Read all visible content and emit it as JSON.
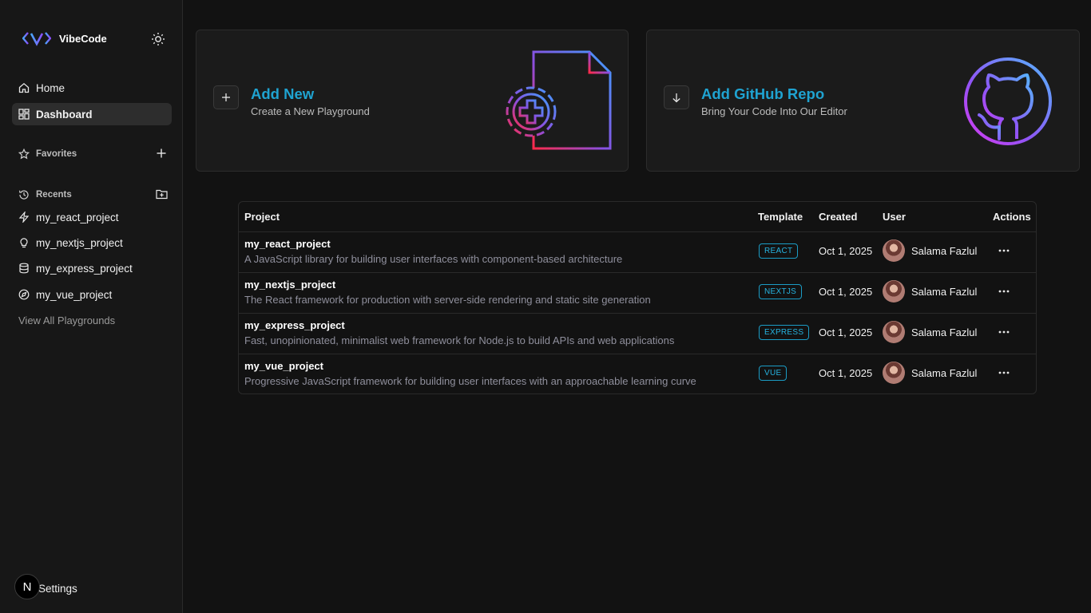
{
  "sidebar": {
    "brand": "VibeCode",
    "nav": [
      {
        "label": "Home"
      },
      {
        "label": "Dashboard"
      }
    ],
    "favorites_label": "Favorites",
    "recents_label": "Recents",
    "recents": [
      {
        "label": "my_react_project",
        "icon": "zap-icon"
      },
      {
        "label": "my_nextjs_project",
        "icon": "lightbulb-icon"
      },
      {
        "label": "my_express_project",
        "icon": "database-icon"
      },
      {
        "label": "my_vue_project",
        "icon": "compass-icon"
      }
    ],
    "view_all": "View All Playgrounds",
    "settings": "Settings",
    "badge": "N"
  },
  "cards": {
    "add_new": {
      "title": "Add New",
      "subtitle": "Create a New Playground"
    },
    "github": {
      "title": "Add GitHub Repo",
      "subtitle": "Bring Your Code Into Our Editor"
    }
  },
  "table": {
    "headers": {
      "project": "Project",
      "template": "Template",
      "created": "Created",
      "user": "User",
      "actions": "Actions"
    },
    "rows": [
      {
        "name": "my_react_project",
        "description": "A JavaScript library for building user interfaces with component-based architecture",
        "template": "REACT",
        "created": "Oct 1, 2025",
        "user": "Salama Fazlul"
      },
      {
        "name": "my_nextjs_project",
        "description": "The React framework for production with server-side rendering and static site generation",
        "template": "NEXTJS",
        "created": "Oct 1, 2025",
        "user": "Salama Fazlul"
      },
      {
        "name": "my_express_project",
        "description": "Fast, unopinionated, minimalist web framework for Node.js to build APIs and web applications",
        "template": "EXPRESS",
        "created": "Oct 1, 2025",
        "user": "Salama Fazlul"
      },
      {
        "name": "my_vue_project",
        "description": "Progressive JavaScript framework for building user interfaces with an approachable learning curve",
        "template": "VUE",
        "created": "Oct 1, 2025",
        "user": "Salama Fazlul"
      }
    ]
  },
  "colors": {
    "background": "#121212",
    "sidebar": "#171717",
    "accent": "#1fa3d1",
    "badge_border": "#1b9cc5"
  }
}
